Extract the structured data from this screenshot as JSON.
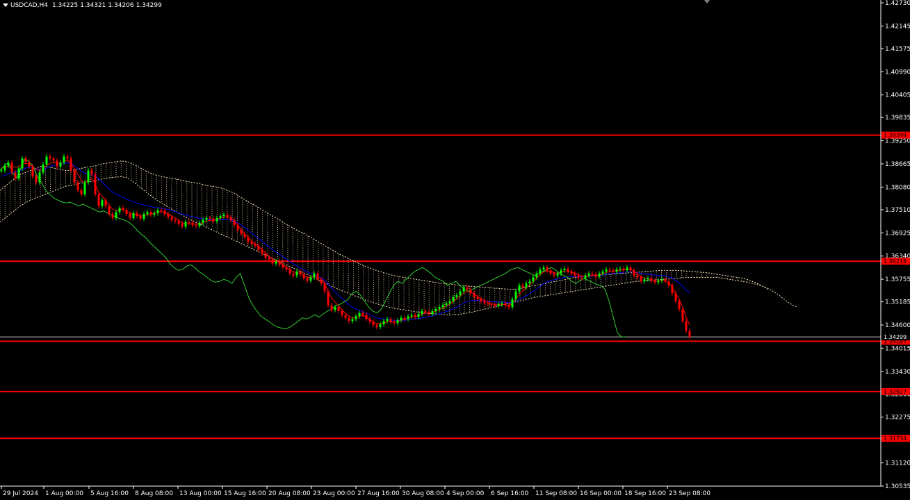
{
  "window": {
    "symbol": "USDCAD,H4",
    "ohlc": [
      "1.34225",
      "1.34321",
      "1.34206",
      "1.34299"
    ]
  },
  "colors": {
    "background": "#000000",
    "axis": "#ffffff",
    "bull_candle": "#00ff00",
    "bear_candle": "#ff0000",
    "tenkan": "#ff0000",
    "kijun": "#0000ff",
    "chikou": "#32cd32",
    "kumo": "#f5deb3",
    "level_line": "#ff0000",
    "current_price_line": "#c0c0c0"
  },
  "chart_data": {
    "type": "candlestick",
    "y_axis_ticks": [
      "1.42730",
      "1.42145",
      "1.41575",
      "1.40990",
      "1.40405",
      "1.39835",
      "1.39250",
      "1.38665",
      "1.38080",
      "1.37510",
      "1.36925",
      "1.36340",
      "1.35755",
      "1.35185",
      "1.34600",
      "1.34015",
      "1.33430",
      "1.32860",
      "1.32275",
      "1.31705",
      "1.31120",
      "1.30535"
    ],
    "ylim": [
      1.30535,
      1.4273
    ],
    "x_axis_ticks": [
      "29 Jul 2024",
      "1 Aug 00:00",
      "5 Aug 16:00",
      "8 Aug 08:00",
      "13 Aug 00:00",
      "15 Aug 16:00",
      "20 Aug 08:00",
      "23 Aug 00:00",
      "27 Aug 16:00",
      "30 Aug 08:00",
      "4 Sep 00:00",
      "6 Sep 16:00",
      "11 Sep 08:00",
      "16 Sep 00:00",
      "18 Sep 16:00",
      "23 Sep 08:00"
    ],
    "horizontal_levels": [
      {
        "value": 1.3939,
        "label": "1.39399"
      },
      {
        "value": 1.3621,
        "label": "1.36218"
      },
      {
        "value": 1.3419,
        "label": "1.34187"
      },
      {
        "value": 1.3292,
        "label": "1.32927"
      },
      {
        "value": 1.3174,
        "label": "1.31734"
      }
    ],
    "current_price": {
      "value": 1.34299,
      "label": "1.34299"
    },
    "close_series": [
      1.385,
      1.3862,
      1.387,
      1.3845,
      1.383,
      1.3855,
      1.388,
      1.3872,
      1.386,
      1.3835,
      1.382,
      1.3845,
      1.3865,
      1.3885,
      1.388,
      1.3875,
      1.386,
      1.387,
      1.3885,
      1.388,
      1.385,
      1.382,
      1.38,
      1.379,
      1.382,
      1.385,
      1.384,
      1.379,
      1.376,
      1.3775,
      1.376,
      1.374,
      1.373,
      1.3745,
      1.3755,
      1.375,
      1.374,
      1.373,
      1.3742,
      1.3735,
      1.3728,
      1.374,
      1.3745,
      1.3738,
      1.3742,
      1.375,
      1.3748,
      1.374,
      1.3732,
      1.3725,
      1.3722,
      1.3715,
      1.3708,
      1.372,
      1.3718,
      1.3712,
      1.371,
      1.3718,
      1.3725,
      1.373,
      1.3728,
      1.3722,
      1.373,
      1.3735,
      1.3738,
      1.3732,
      1.3725,
      1.3712,
      1.37,
      1.369,
      1.3682,
      1.367,
      1.3665,
      1.366,
      1.365,
      1.364,
      1.363,
      1.3625,
      1.3615,
      1.362,
      1.3612,
      1.3605,
      1.36,
      1.359,
      1.3585,
      1.3595,
      1.3588,
      1.3578,
      1.3572,
      1.358,
      1.359,
      1.3575,
      1.3565,
      1.3545,
      1.351,
      1.3498,
      1.3505,
      1.3495,
      1.3485,
      1.3478,
      1.347,
      1.3475,
      1.3482,
      1.349,
      1.3486,
      1.3475,
      1.3468,
      1.346,
      1.3455,
      1.3462,
      1.347,
      1.3475,
      1.3468,
      1.3465,
      1.3472,
      1.3478,
      1.3475,
      1.3482,
      1.3485,
      1.348,
      1.3488,
      1.3495,
      1.3492,
      1.3488,
      1.3495,
      1.35,
      1.3505,
      1.351,
      1.3515,
      1.352,
      1.353,
      1.3535,
      1.3545,
      1.3555,
      1.355,
      1.354,
      1.353,
      1.3525,
      1.352,
      1.3515,
      1.3512,
      1.351,
      1.3508,
      1.3512,
      1.3515,
      1.351,
      1.3505,
      1.3525,
      1.3545,
      1.356,
      1.3555,
      1.3565,
      1.357,
      1.358,
      1.359,
      1.36,
      1.3605,
      1.3598,
      1.359,
      1.3585,
      1.359,
      1.3598,
      1.3602,
      1.3595,
      1.359,
      1.3585,
      1.358,
      1.3578,
      1.3585,
      1.359,
      1.3588,
      1.3582,
      1.359,
      1.3595,
      1.36,
      1.3598,
      1.3595,
      1.36,
      1.3602,
      1.3598,
      1.3605,
      1.3598,
      1.3585,
      1.358,
      1.357,
      1.3575,
      1.3578,
      1.3572,
      1.3568,
      1.3572,
      1.3575,
      1.357,
      1.356,
      1.354,
      1.352,
      1.35,
      1.347,
      1.3445,
      1.343
    ],
    "tenkan_series": [
      1.3855,
      1.3858,
      1.3862,
      1.386,
      1.3858,
      1.386,
      1.3865,
      1.3868,
      1.3866,
      1.386,
      1.3852,
      1.385,
      1.3855,
      1.3862,
      1.3868,
      1.387,
      1.3868,
      1.3868,
      1.3872,
      1.3875,
      1.3868,
      1.3855,
      1.384,
      1.3825,
      1.3818,
      1.3825,
      1.383,
      1.3815,
      1.3795,
      1.3785,
      1.3775,
      1.3762,
      1.3752,
      1.3748,
      1.3752,
      1.3752,
      1.3748,
      1.3742,
      1.374,
      1.3738,
      1.3735,
      1.3736,
      1.3738,
      1.374,
      1.3742,
      1.3745,
      1.3746,
      1.3744,
      1.374,
      1.3735,
      1.373,
      1.3724,
      1.3718,
      1.3716,
      1.3716,
      1.3715,
      1.3714,
      1.3715,
      1.3718,
      1.3722,
      1.3724,
      1.3724,
      1.3726,
      1.373,
      1.3733,
      1.3733,
      1.373,
      1.3722,
      1.3712,
      1.37,
      1.369,
      1.368,
      1.3672,
      1.3665,
      1.3658,
      1.365,
      1.3642,
      1.3634,
      1.3626,
      1.3622,
      1.3618,
      1.3612,
      1.3606,
      1.36,
      1.3594,
      1.3592,
      1.359,
      1.3586,
      1.358,
      1.358,
      1.3583,
      1.358,
      1.3575,
      1.3565,
      1.3545,
      1.3528,
      1.3518,
      1.3508,
      1.3498,
      1.349,
      1.3482,
      1.3478,
      1.3478,
      1.3482,
      1.3484,
      1.348,
      1.3474,
      1.3468,
      1.3463,
      1.3463,
      1.3465,
      1.3468,
      1.3468,
      1.3467,
      1.3469,
      1.3472,
      1.3474,
      1.3477,
      1.348,
      1.3481,
      1.3484,
      1.3488,
      1.349,
      1.349,
      1.3492,
      1.3495,
      1.3499,
      1.3503,
      1.3508,
      1.3513,
      1.352,
      1.3526,
      1.3533,
      1.3541,
      1.3545,
      1.3543,
      1.3538,
      1.3532,
      1.3527,
      1.3522,
      1.3517,
      1.3514,
      1.3511,
      1.3511,
      1.3512,
      1.3511,
      1.3509,
      1.3514,
      1.3525,
      1.3538,
      1.3546,
      1.3554,
      1.3561,
      1.3569,
      1.3578,
      1.3587,
      1.3594,
      1.3597,
      1.3595,
      1.3592,
      1.3591,
      1.3593,
      1.3596,
      1.3596,
      1.3594,
      1.3591,
      1.3587,
      1.3583,
      1.3583,
      1.3585,
      1.3586,
      1.3585,
      1.3586,
      1.3589,
      1.3593,
      1.3595,
      1.3596,
      1.3597,
      1.3599,
      1.3599,
      1.36,
      1.36,
      1.3595,
      1.359,
      1.3582,
      1.3578,
      1.3576,
      1.3574,
      1.3572,
      1.3571,
      1.3572,
      1.3571,
      1.3567,
      1.3555,
      1.354,
      1.3525,
      1.3505,
      1.348,
      1.346
    ],
    "kijun_series": [
      1.3835,
      1.3838,
      1.3842,
      1.3845,
      1.3846,
      1.3848,
      1.3852,
      1.3856,
      1.3858,
      1.3857,
      1.3854,
      1.3852,
      1.3853,
      1.3856,
      1.386,
      1.3863,
      1.3864,
      1.3865,
      1.3867,
      1.3869,
      1.3867,
      1.3862,
      1.3855,
      1.3848,
      1.3843,
      1.3843,
      1.3842,
      1.3836,
      1.3828,
      1.382,
      1.3812,
      1.3804,
      1.3796,
      1.379,
      1.3786,
      1.3782,
      1.3778,
      1.3774,
      1.3771,
      1.3768,
      1.3765,
      1.3763,
      1.3761,
      1.3759,
      1.3757,
      1.3756,
      1.3755,
      1.3753,
      1.3751,
      1.3749,
      1.3746,
      1.3743,
      1.374,
      1.3737,
      1.3735,
      1.3733,
      1.3731,
      1.3729,
      1.3728,
      1.3727,
      1.3726,
      1.3725,
      1.3725,
      1.3725,
      1.3726,
      1.3726,
      1.3725,
      1.3722,
      1.3718,
      1.3712,
      1.3706,
      1.3699,
      1.3692,
      1.3685,
      1.3678,
      1.3671,
      1.3664,
      1.3657,
      1.365,
      1.3644,
      1.3638,
      1.3632,
      1.3626,
      1.362,
      1.3614,
      1.3609,
      1.3604,
      1.3599,
      1.3594,
      1.359,
      1.3587,
      1.3583,
      1.3579,
      1.3573,
      1.3563,
      1.3553,
      1.3544,
      1.3535,
      1.3527,
      1.3519,
      1.3511,
      1.3505,
      1.35,
      1.3497,
      1.3494,
      1.349,
      1.3486,
      1.3482,
      1.3478,
      1.3476,
      1.3475,
      1.3474,
      1.3473,
      1.3472,
      1.3472,
      1.3472,
      1.3472,
      1.3473,
      1.3474,
      1.3475,
      1.3476,
      1.3478,
      1.348,
      1.3481,
      1.3483,
      1.3485,
      1.3488,
      1.3491,
      1.3494,
      1.3497,
      1.3501,
      1.3505,
      1.351,
      1.3515,
      1.3519,
      1.3521,
      1.3522,
      1.3522,
      1.3522,
      1.3521,
      1.352,
      1.3519,
      1.3518,
      1.3518,
      1.3518,
      1.3517,
      1.3516,
      1.3517,
      1.352,
      1.3525,
      1.3529,
      1.3534,
      1.3539,
      1.3545,
      1.3551,
      1.3558,
      1.3564,
      1.3569,
      1.3572,
      1.3574,
      1.3576,
      1.3578,
      1.358,
      1.3581,
      1.3582,
      1.3582,
      1.3582,
      1.3582,
      1.3583,
      1.3584,
      1.3584,
      1.3584,
      1.3585,
      1.3586,
      1.3588,
      1.3589,
      1.359,
      1.3591,
      1.3592,
      1.3593,
      1.3594,
      1.3594,
      1.3593,
      1.3592,
      1.359,
      1.3589,
      1.3588,
      1.3587,
      1.3586,
      1.3585,
      1.3585,
      1.3584,
      1.3582,
      1.3578,
      1.3572,
      1.3566,
      1.3558,
      1.3548,
      1.354
    ],
    "chikou_series": [
      1.385,
      1.3862,
      1.387,
      1.3845,
      1.383,
      1.3855,
      1.388,
      1.3872,
      1.386,
      1.3835,
      1.382,
      1.38,
      1.379,
      1.378,
      1.3775,
      1.377,
      1.3768,
      1.377,
      1.3765,
      1.376,
      1.3765,
      1.376,
      1.3755,
      1.375,
      1.3745,
      1.3748,
      1.3742,
      1.3738,
      1.3732,
      1.3728,
      1.3725,
      1.372,
      1.3712,
      1.37,
      1.369,
      1.3682,
      1.367,
      1.366,
      1.365,
      1.364,
      1.363,
      1.3615,
      1.3605,
      1.3598,
      1.36,
      1.3608,
      1.3612,
      1.3605,
      1.3595,
      1.3588,
      1.358,
      1.3572,
      1.3568,
      1.357,
      1.3575,
      1.3572,
      1.3565,
      1.358,
      1.359,
      1.356,
      1.353,
      1.351,
      1.3495,
      1.3482,
      1.3475,
      1.3468,
      1.346,
      1.3455,
      1.3452,
      1.345,
      1.3455,
      1.3462,
      1.347,
      1.3478,
      1.3475,
      1.348,
      1.3486,
      1.348,
      1.3488,
      1.3495,
      1.35,
      1.3508,
      1.3512,
      1.3518,
      1.3525,
      1.354,
      1.3545,
      1.3535,
      1.352,
      1.3505,
      1.3495,
      1.349,
      1.35,
      1.352,
      1.354,
      1.356,
      1.357,
      1.3565,
      1.3575,
      1.3585,
      1.3595,
      1.36,
      1.3605,
      1.3598,
      1.359,
      1.358,
      1.3575,
      1.357,
      1.356,
      1.3565,
      1.357,
      1.356,
      1.355,
      1.3545,
      1.355,
      1.3555,
      1.356,
      1.3565,
      1.357,
      1.3575,
      1.358,
      1.3585,
      1.359,
      1.3598,
      1.3602,
      1.3605,
      1.36,
      1.3595,
      1.359,
      1.3585,
      1.359,
      1.3595,
      1.36,
      1.3605,
      1.36,
      1.359,
      1.3585,
      1.358,
      1.357,
      1.3565,
      1.3572,
      1.3578,
      1.3572,
      1.3568,
      1.3562,
      1.356,
      1.355,
      1.352,
      1.348,
      1.344,
      1.343,
      1.343
    ],
    "kumo_upper_series": [
      1.38,
      1.381,
      1.382,
      1.383,
      1.384,
      1.3845,
      1.385,
      1.3855,
      1.386,
      1.386,
      1.3858,
      1.3855,
      1.3852,
      1.385,
      1.385,
      1.3852,
      1.3855,
      1.3858,
      1.386,
      1.3862,
      1.3866,
      1.3868,
      1.387,
      1.3872,
      1.3874,
      1.3872,
      1.3868,
      1.3862,
      1.3855,
      1.3848,
      1.3842,
      1.3838,
      1.3835,
      1.3832,
      1.383,
      1.3828,
      1.3825,
      1.3822,
      1.382,
      1.3818,
      1.3815,
      1.3812,
      1.381,
      1.3808,
      1.3805,
      1.38,
      1.3795,
      1.3788,
      1.378,
      1.3772,
      1.3765,
      1.3758,
      1.375,
      1.3742,
      1.3735,
      1.3728,
      1.372,
      1.3712,
      1.3705,
      1.3698,
      1.3692,
      1.3685,
      1.3678,
      1.367,
      1.3663,
      1.3655,
      1.3648,
      1.364,
      1.3634,
      1.3628,
      1.3622,
      1.3616,
      1.361,
      1.3605,
      1.36,
      1.3596,
      1.3592,
      1.3588,
      1.3585,
      1.3582,
      1.358,
      1.3578,
      1.3576,
      1.3574,
      1.3572,
      1.357,
      1.3568,
      1.3566,
      1.3565,
      1.3563,
      1.3562,
      1.356,
      1.3559,
      1.3558,
      1.3557,
      1.3556,
      1.3555,
      1.3554,
      1.3553,
      1.3552,
      1.3551,
      1.355,
      1.355,
      1.3552,
      1.3555,
      1.3558,
      1.356,
      1.3562,
      1.3565,
      1.3568,
      1.357,
      1.3572,
      1.3575,
      1.3578,
      1.358,
      1.3582,
      1.3583,
      1.3584,
      1.3585,
      1.3586,
      1.3587,
      1.3588,
      1.3589,
      1.359,
      1.3591,
      1.3592,
      1.3593,
      1.3594,
      1.3595,
      1.3596,
      1.3597,
      1.3598,
      1.3598,
      1.3598,
      1.3598,
      1.3597,
      1.3596,
      1.3595,
      1.3594,
      1.3593,
      1.3592,
      1.359,
      1.3588,
      1.3586,
      1.3584,
      1.3582,
      1.358,
      1.3578,
      1.3575,
      1.357,
      1.3565,
      1.3558,
      1.355
    ],
    "kumo_lower_series": [
      1.372,
      1.373,
      1.374,
      1.375,
      1.376,
      1.3768,
      1.3775,
      1.378,
      1.3785,
      1.379,
      1.3795,
      1.38,
      1.3805,
      1.381,
      1.3812,
      1.3815,
      1.3818,
      1.382,
      1.3822,
      1.3825,
      1.3828,
      1.383,
      1.3832,
      1.3833,
      1.3834,
      1.3832,
      1.3825,
      1.3815,
      1.3805,
      1.3795,
      1.3785,
      1.3775,
      1.3768,
      1.376,
      1.3752,
      1.3745,
      1.3738,
      1.373,
      1.3724,
      1.3718,
      1.3712,
      1.3706,
      1.37,
      1.3694,
      1.3688,
      1.3682,
      1.3676,
      1.367,
      1.3664,
      1.3658,
      1.3652,
      1.3646,
      1.364,
      1.3634,
      1.3628,
      1.3622,
      1.3616,
      1.361,
      1.3604,
      1.3598,
      1.3592,
      1.3586,
      1.358,
      1.3574,
      1.3568,
      1.3562,
      1.3556,
      1.355,
      1.3545,
      1.354,
      1.3535,
      1.353,
      1.3525,
      1.352,
      1.3516,
      1.3512,
      1.3508,
      1.3505,
      1.3502,
      1.35,
      1.3498,
      1.3496,
      1.3494,
      1.3492,
      1.349,
      1.3489,
      1.3488,
      1.3487,
      1.3486,
      1.3485,
      1.3486,
      1.3487,
      1.3489,
      1.3491,
      1.3494,
      1.3497,
      1.35,
      1.3503,
      1.3506,
      1.3509,
      1.3512,
      1.3515,
      1.3518,
      1.3521,
      1.3524,
      1.3527,
      1.353,
      1.3532,
      1.3534,
      1.3536,
      1.3538,
      1.354,
      1.3542,
      1.3544,
      1.3546,
      1.3548,
      1.355,
      1.3552,
      1.3554,
      1.3556,
      1.3558,
      1.356,
      1.3562,
      1.3564,
      1.3566,
      1.3568,
      1.357,
      1.3571,
      1.3572,
      1.3573,
      1.3574,
      1.3575,
      1.3576,
      1.3577,
      1.3578,
      1.3579,
      1.358,
      1.358,
      1.358,
      1.358,
      1.358,
      1.358,
      1.358,
      1.3578,
      1.3576,
      1.3574,
      1.3572,
      1.357,
      1.3568,
      1.3565,
      1.3562,
      1.3558,
      1.3553,
      1.3546,
      1.3538,
      1.3528,
      1.3518,
      1.351,
      1.3505
    ]
  }
}
